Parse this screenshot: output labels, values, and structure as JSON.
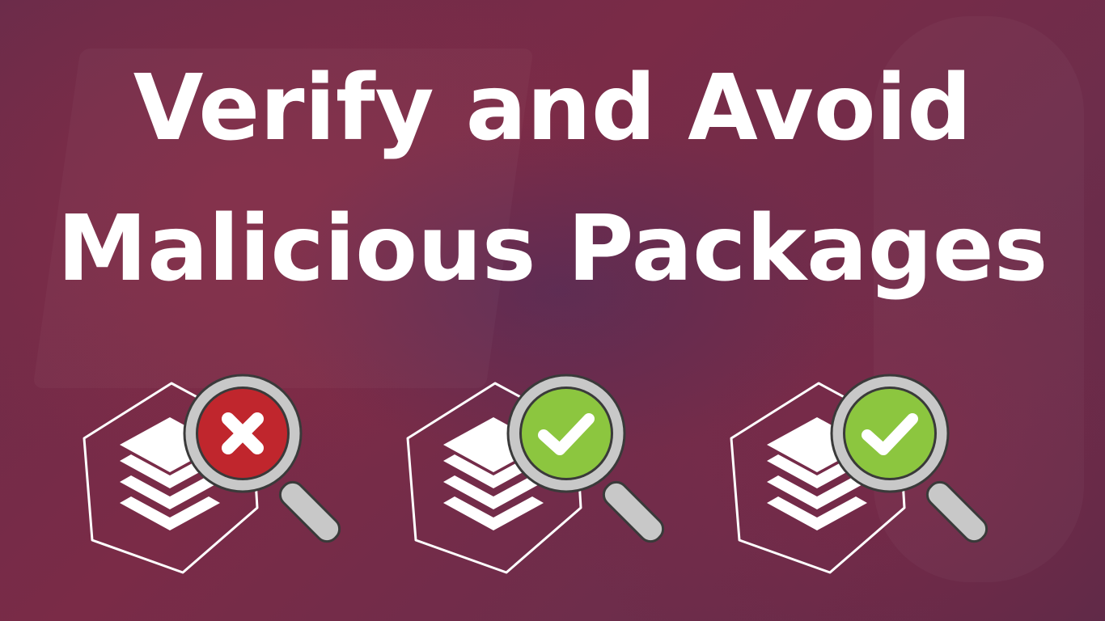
{
  "headline": {
    "line1": "Verify and Avoid",
    "line2": "Malicious Packages"
  },
  "colors": {
    "background": "#722c4a",
    "text": "#ffffff",
    "fail_badge": "#c0262d",
    "pass_badge": "#8cc63f",
    "magnifier_ring": "#c8c8c8",
    "outline": "#3a3a3a"
  },
  "icons": [
    {
      "name": "package-stack-icon",
      "badge": "x-mark-icon",
      "status": "fail"
    },
    {
      "name": "package-stack-icon",
      "badge": "checkmark-icon",
      "status": "pass"
    },
    {
      "name": "package-stack-icon",
      "badge": "checkmark-icon",
      "status": "pass"
    }
  ]
}
